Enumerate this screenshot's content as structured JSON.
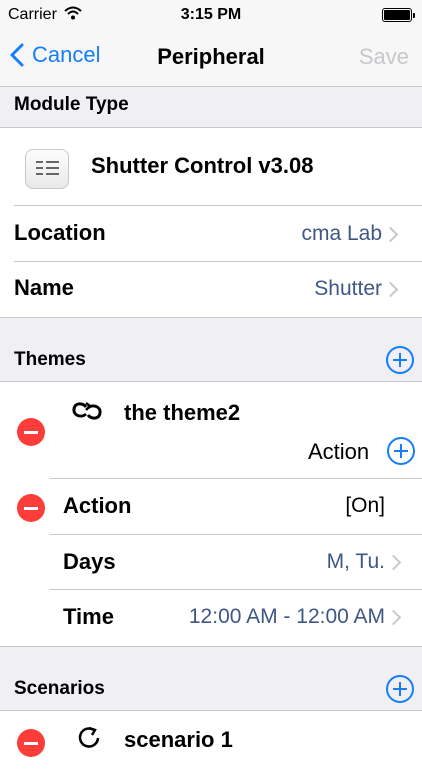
{
  "status_bar": {
    "carrier": "Carrier",
    "time": "3:15 PM"
  },
  "nav": {
    "back_label": "Cancel",
    "title": "Peripheral",
    "save_label": "Save"
  },
  "module_type": {
    "header": "Module Type",
    "name": "Shutter Control v3.08"
  },
  "location": {
    "label": "Location",
    "value": "cma Lab"
  },
  "name_row": {
    "label": "Name",
    "value": "Shutter"
  },
  "themes": {
    "header": "Themes",
    "theme_name": "the theme2",
    "add_action_label": "Action",
    "action": {
      "label": "Action",
      "value": "[On]"
    },
    "days": {
      "label": "Days",
      "value": "M, Tu."
    },
    "time": {
      "label": "Time",
      "value": "12:00 AM - 12:00 AM"
    }
  },
  "scenarios": {
    "header": "Scenarios",
    "scenario_name": "scenario 1"
  },
  "colors": {
    "tint": "#157efb",
    "delete": "#fc3d39",
    "value_text": "#3f5785",
    "disabled": "#c7c7cc"
  }
}
